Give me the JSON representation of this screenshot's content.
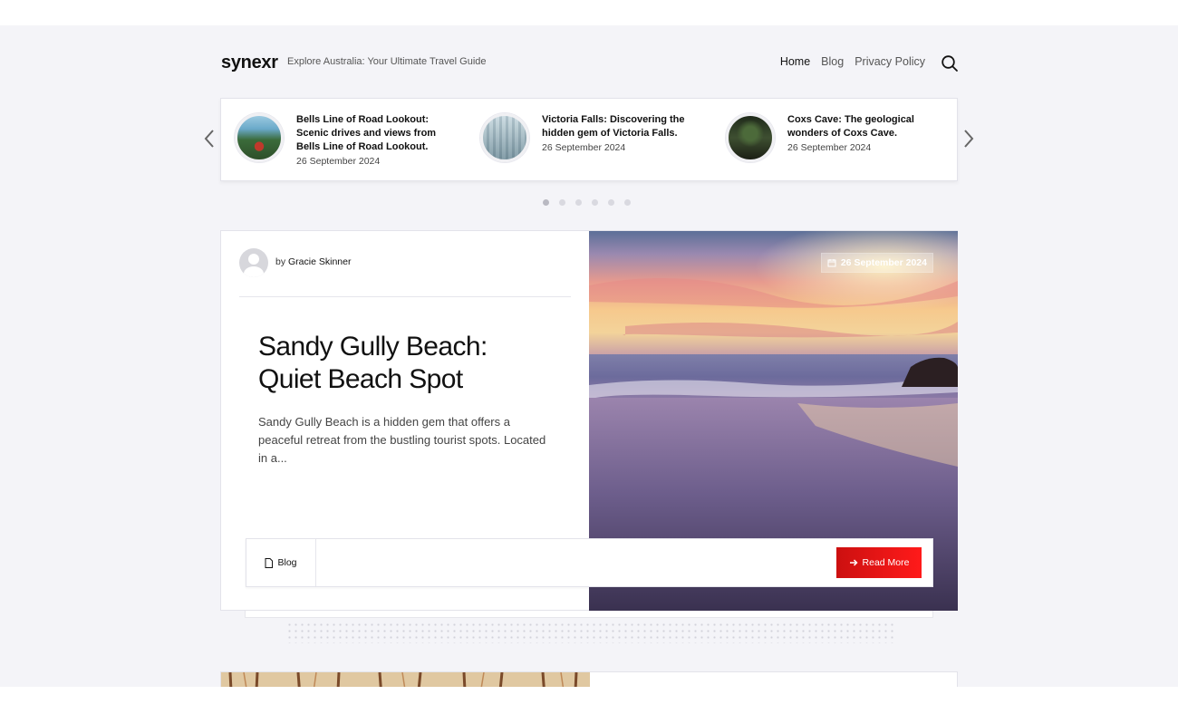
{
  "site": {
    "brand": "synexr",
    "tagline": "Explore Australia: Your Ultimate Travel Guide"
  },
  "nav": {
    "items": [
      {
        "label": "Home"
      },
      {
        "label": "Blog"
      },
      {
        "label": "Privacy Policy"
      }
    ],
    "search_icon": "search-icon"
  },
  "slider": {
    "slides": [
      {
        "title": "Bells Line of Road Lookout: Scenic drives and views from Bells Line of Road Lookout.",
        "date": "26 September 2024"
      },
      {
        "title": "Victoria Falls: Discovering the hidden gem of Victoria Falls.",
        "date": "26 September 2024"
      },
      {
        "title": "Coxs Cave: The geological wonders of Coxs Cave.",
        "date": "26 September 2024"
      }
    ],
    "prev_icon": "chevron-left-icon",
    "next_icon": "chevron-right-icon",
    "dot_count": 6,
    "active_dot": 1
  },
  "post": {
    "by": "by",
    "author": "Gracie Skinner",
    "title": "Sandy Gully Beach: Quiet Beach Spot",
    "excerpt": "Sandy Gully Beach is a hidden gem that offers a peaceful retreat from the bustling tourist spots. Located in a...",
    "date": "26 September 2024",
    "category": "Blog",
    "read_more": "Read More"
  },
  "colors": {
    "accent": "#e31212",
    "page_bg": "#f4f4f8"
  }
}
